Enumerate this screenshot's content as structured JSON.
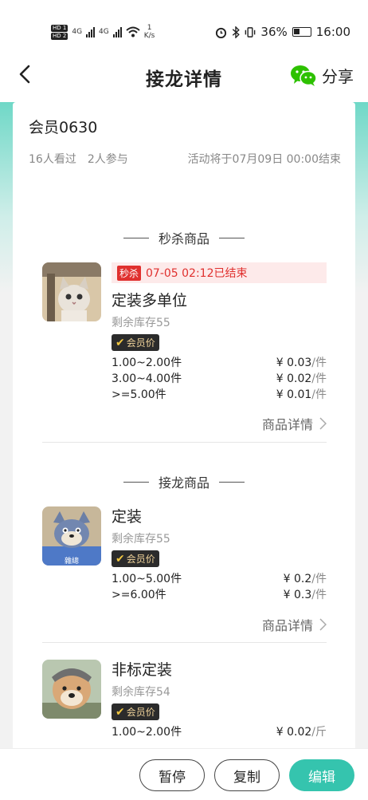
{
  "status": {
    "net_speed_value": "1",
    "net_speed_unit": "K/s",
    "battery": "36%",
    "time": "16:00",
    "hd1": "HD 1",
    "hd2": "HD 2",
    "sig1": "4G",
    "sig2": "4G"
  },
  "nav": {
    "title": "接龙详情",
    "share": "分享"
  },
  "activity": {
    "title": "会员0630",
    "views": "16人看过",
    "participants": "2人参与",
    "end_text": "活动将于07月09日 00:00结束"
  },
  "sections": {
    "flash_sale": "秒杀商品",
    "relay": "接龙商品"
  },
  "products": [
    {
      "flash_tag": "秒杀",
      "flash_text": "07-05 02:12已结束",
      "name": "定装多单位",
      "stock": "剩余库存55",
      "vip": "会员价",
      "tiers": [
        {
          "qty": "1.00~2.00件",
          "price": "¥ 0.03",
          "unit": "/件"
        },
        {
          "qty": "3.00~4.00件",
          "price": "¥ 0.02",
          "unit": "/件"
        },
        {
          "qty": ">=5.00件",
          "price": "¥ 0.01",
          "unit": "/件"
        }
      ],
      "detail": "商品详情"
    },
    {
      "name": "定装",
      "stock": "剩余库存55",
      "vip": "会员价",
      "image_caption": "雜總",
      "tiers": [
        {
          "qty": "1.00~5.00件",
          "price": "¥ 0.2",
          "unit": "/件"
        },
        {
          "qty": ">=6.00件",
          "price": "¥ 0.3",
          "unit": "/件"
        }
      ],
      "detail": "商品详情"
    },
    {
      "name": "非标定装",
      "stock": "剩余库存54",
      "vip": "会员价",
      "tiers": [
        {
          "qty": "1.00~2.00件",
          "price": "¥ 0.02",
          "unit": "/斤"
        }
      ]
    }
  ],
  "actions": {
    "pause": "暂停",
    "copy": "复制",
    "edit": "编辑"
  },
  "colors": {
    "accent": "#35c4ae",
    "flash_red": "#e0302e",
    "wechat_green": "#2dc100"
  }
}
